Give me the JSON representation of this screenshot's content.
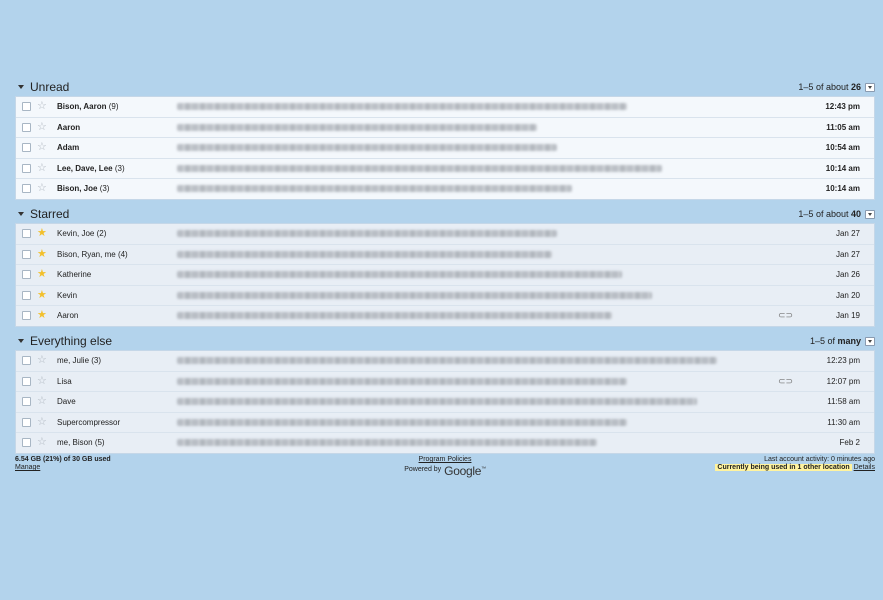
{
  "sections": {
    "unread": {
      "title": "Unread",
      "count_prefix": "1–5 of about",
      "count_total": "26",
      "rows": [
        {
          "sender": "Bison, Aaron",
          "n": "(9)",
          "date": "12:43 pm",
          "snippet_w": 450,
          "star": false
        },
        {
          "sender": "Aaron",
          "n": "",
          "date": "11:05 am",
          "snippet_w": 360,
          "star": false
        },
        {
          "sender": "Adam",
          "n": "",
          "date": "10:54 am",
          "snippet_w": 380,
          "star": false
        },
        {
          "sender": "Lee, Dave, Lee",
          "n": "(3)",
          "date": "10:14 am",
          "snippet_w": 485,
          "star": false
        },
        {
          "sender": "Bison, Joe",
          "n": "(3)",
          "date": "10:14 am",
          "snippet_w": 395,
          "star": false
        }
      ]
    },
    "starred": {
      "title": "Starred",
      "count_prefix": "1–5 of about",
      "count_total": "40",
      "rows": [
        {
          "sender": "Kevin, Joe",
          "n": "(2)",
          "date": "Jan 27",
          "snippet_w": 380,
          "star": true,
          "clip": false
        },
        {
          "sender": "Bison, Ryan, me",
          "n": "(4)",
          "date": "Jan 27",
          "snippet_w": 375,
          "star": true,
          "clip": false
        },
        {
          "sender": "Katherine",
          "n": "",
          "date": "Jan 26",
          "snippet_w": 445,
          "star": true,
          "clip": false
        },
        {
          "sender": "Kevin",
          "n": "",
          "date": "Jan 20",
          "snippet_w": 475,
          "star": true,
          "clip": false
        },
        {
          "sender": "Aaron",
          "n": "",
          "date": "Jan 19",
          "snippet_w": 435,
          "star": true,
          "clip": true
        }
      ]
    },
    "everything": {
      "title": "Everything else",
      "count_prefix": "1–5 of",
      "count_total": "many",
      "rows": [
        {
          "sender": "me, Julie",
          "n": "(3)",
          "date": "12:23 pm",
          "snippet_w": 540,
          "star": false,
          "clip": false
        },
        {
          "sender": "Lisa",
          "n": "",
          "date": "12:07 pm",
          "snippet_w": 450,
          "star": false,
          "clip": true
        },
        {
          "sender": "Dave",
          "n": "",
          "date": "11:58 am",
          "snippet_w": 520,
          "star": false,
          "clip": false
        },
        {
          "sender": "Supercompressor",
          "n": "",
          "date": "11:30 am",
          "snippet_w": 450,
          "star": false,
          "clip": false
        },
        {
          "sender": "me, Bison",
          "n": "(5)",
          "date": "Feb 2",
          "snippet_w": 420,
          "star": false,
          "clip": false
        }
      ]
    }
  },
  "footer": {
    "storage": "6.54 GB (21%) of 30 GB used",
    "manage": "Manage",
    "program_policies": "Program Policies",
    "powered_by": "Powered by",
    "google": "Google",
    "tm": "™",
    "last_activity": "Last account activity: 0 minutes ago",
    "other_location": "Currently being used in 1 other location",
    "details": "Details"
  },
  "colors": {
    "background": "#b3d3ec",
    "star_on": "#f2c02c",
    "highlight": "#fff39e"
  }
}
